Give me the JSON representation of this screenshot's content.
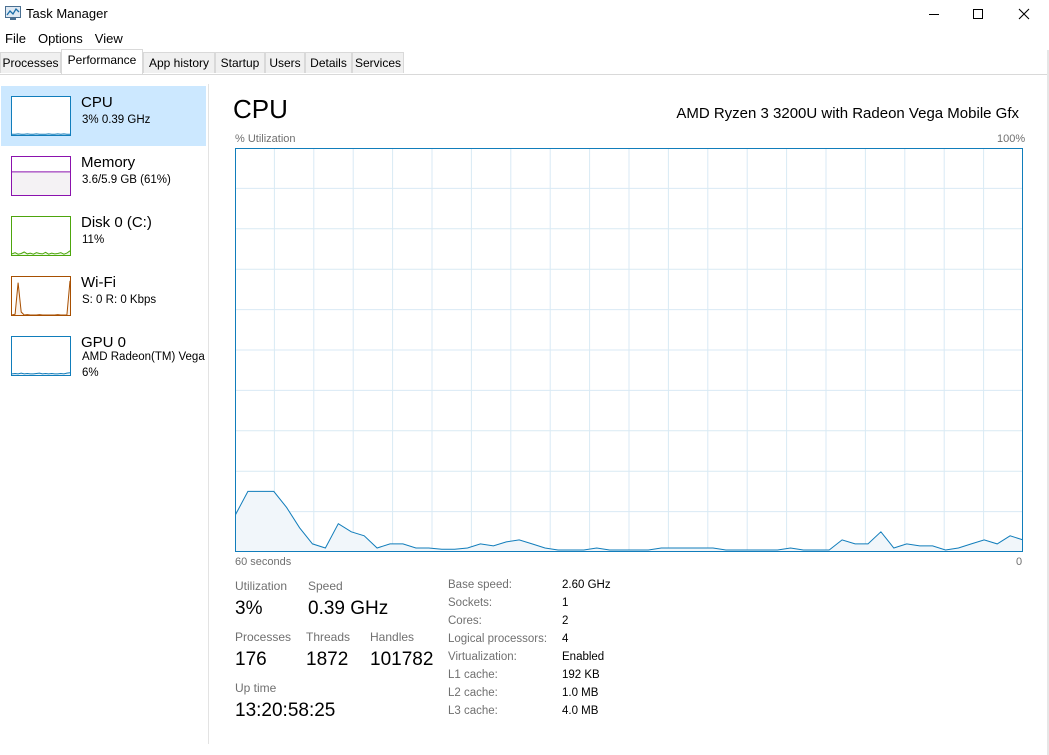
{
  "window": {
    "title": "Task Manager",
    "controls": [
      "minimize",
      "maximize",
      "close"
    ]
  },
  "menu": [
    "File",
    "Options",
    "View"
  ],
  "tabs": [
    {
      "label": "Processes",
      "active": false
    },
    {
      "label": "Performance",
      "active": true
    },
    {
      "label": "App history",
      "active": false
    },
    {
      "label": "Startup",
      "active": false
    },
    {
      "label": "Users",
      "active": false
    },
    {
      "label": "Details",
      "active": false
    },
    {
      "label": "Services",
      "active": false
    }
  ],
  "sidebar": {
    "items": [
      {
        "name": "CPU",
        "sub": "3%  0.39 GHz",
        "sub2": "",
        "color": "#117dbb",
        "fill": "#f1f6fa",
        "selected": true,
        "spark": [
          2,
          2,
          3,
          2,
          2,
          3,
          2,
          2,
          3,
          2,
          2,
          2,
          3,
          2,
          2,
          3,
          2,
          3,
          2,
          2
        ]
      },
      {
        "name": "Memory",
        "sub": "3.6/5.9 GB (61%)",
        "sub2": "",
        "color": "#8b12ae",
        "fill": "#f4f2f4",
        "selected": false,
        "level": 61
      },
      {
        "name": "Disk 0 (C:)",
        "sub": "11%",
        "sub2": "",
        "color": "#4da60c",
        "fill": "#eff8ea",
        "selected": false,
        "spark": [
          3,
          6,
          2,
          4,
          8,
          3,
          5,
          2,
          6,
          4,
          3,
          7,
          2,
          5,
          3,
          4,
          6,
          2,
          5,
          11
        ]
      },
      {
        "name": "Wi-Fi",
        "sub": "S: 0  R: 0 Kbps",
        "sub2": "",
        "color": "#a74f01",
        "fill": "#fcf3eb",
        "selected": false,
        "spark": [
          0,
          2,
          85,
          8,
          0,
          1,
          0,
          0,
          0,
          1,
          0,
          0,
          0,
          0,
          0,
          1,
          0,
          0,
          0,
          90
        ]
      },
      {
        "name": "GPU 0",
        "sub": "AMD Radeon(TM) Vega",
        "sub2": "6%",
        "color": "#117dbb",
        "fill": "#f1f6fa",
        "selected": false,
        "spark": [
          3,
          4,
          3,
          5,
          3,
          4,
          3,
          3,
          4,
          5,
          3,
          4,
          3,
          4,
          3,
          3,
          4,
          3,
          5,
          6
        ]
      }
    ]
  },
  "main": {
    "title": "CPU",
    "model": "AMD Ryzen 3 3200U with Radeon Vega Mobile Gfx",
    "graph": {
      "y_label": "% Utilization",
      "y_max_label": "100%",
      "x_left_label": "60 seconds",
      "x_right_label": "0",
      "line_color": "#117dbb",
      "fill_color": "#f1f6fa",
      "grid_color": "#d9eaf4",
      "values": [
        9,
        15,
        15,
        15,
        11,
        6,
        2,
        1,
        7,
        5,
        4,
        1,
        2,
        2,
        1,
        1,
        0.7,
        0.7,
        1,
        2,
        1.5,
        2.5,
        3,
        2,
        1,
        0.5,
        0.5,
        0.5,
        1,
        0.5,
        0.5,
        0.5,
        0.5,
        1,
        1,
        1,
        1,
        1,
        0.5,
        0.5,
        0.5,
        0.5,
        0.5,
        1,
        0.5,
        0.5,
        0.5,
        3,
        2,
        2,
        5,
        1,
        2,
        1.5,
        1.5,
        0.5,
        1,
        2,
        3,
        2,
        4,
        3
      ]
    },
    "stats": {
      "utilization_label": "Utilization",
      "utilization": "3%",
      "speed_label": "Speed",
      "speed": "0.39 GHz",
      "processes_label": "Processes",
      "processes": "176",
      "threads_label": "Threads",
      "threads": "1872",
      "handles_label": "Handles",
      "handles": "101782",
      "uptime_label": "Up time",
      "uptime": "13:20:58:25"
    },
    "specs": [
      {
        "label": "Base speed:",
        "value": "2.60 GHz"
      },
      {
        "label": "Sockets:",
        "value": "1"
      },
      {
        "label": "Cores:",
        "value": "2"
      },
      {
        "label": "Logical processors:",
        "value": "4"
      },
      {
        "label": "Virtualization:",
        "value": "Enabled"
      },
      {
        "label": "L1 cache:",
        "value": "192 KB"
      },
      {
        "label": "L2 cache:",
        "value": "1.0 MB"
      },
      {
        "label": "L3 cache:",
        "value": "4.0 MB"
      }
    ]
  }
}
